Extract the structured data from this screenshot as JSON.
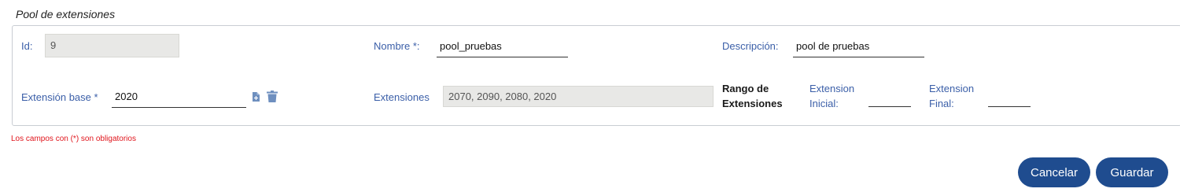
{
  "section": {
    "title": "Pool de extensiones"
  },
  "fields": {
    "id": {
      "label": "Id:",
      "value": "9"
    },
    "nombre": {
      "label": "Nombre *:",
      "value": "pool_pruebas"
    },
    "descripcion": {
      "label": "Descripción:",
      "value": "pool de pruebas"
    },
    "extension_base": {
      "label": "Extensión base *",
      "value": "2020"
    },
    "extensiones": {
      "label": "Extensiones",
      "value": "2070, 2090, 2080, 2020"
    },
    "rango": {
      "title_line1": "Rango de",
      "title_line2": "Extensiones",
      "inicial_line1": "Extension",
      "inicial_line2": "Inicial:",
      "inicial_value": "",
      "final_line1": "Extension",
      "final_line2": "Final:",
      "final_value": ""
    }
  },
  "icons": {
    "add": "file-add-icon",
    "delete": "trash-icon"
  },
  "note": "Los campos con (*) son obligatorios",
  "buttons": {
    "cancel": "Cancelar",
    "save": "Guardar"
  },
  "colors": {
    "primary": "#1f4c8f",
    "label": "#3b5fa8",
    "error": "#e0151c"
  }
}
